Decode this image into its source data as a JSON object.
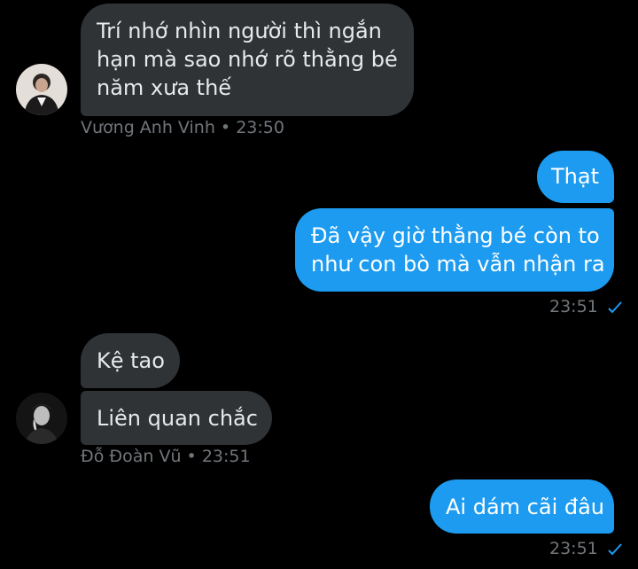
{
  "accent_color": "#1d9bf0",
  "received_bubble_color": "#2f3336",
  "messages": [
    {
      "lines": [
        "Trí nhớ nhìn người thì ngắn",
        "hạn mà sao nhớ rõ thằng bé",
        "năm xưa thế"
      ],
      "direction": "received"
    },
    {
      "lines": [
        "Thạt"
      ],
      "direction": "sent"
    },
    {
      "lines": [
        "Đã vậy giờ thằng bé còn to",
        "như con bò mà vẫn nhận ra"
      ],
      "direction": "sent"
    },
    {
      "lines": [
        "Kệ tao"
      ],
      "direction": "received"
    },
    {
      "lines": [
        "Liên quan chắc"
      ],
      "direction": "received"
    },
    {
      "lines": [
        "Ai dám cãi đâu"
      ],
      "direction": "sent"
    }
  ],
  "meta": [
    {
      "sender": "Vương Anh Vinh",
      "separator": "•",
      "time": "23:50"
    },
    {
      "time": "23:51",
      "status_icon": "check-icon"
    },
    {
      "sender": "Đỗ Đoàn Vũ",
      "separator": "•",
      "time": "23:51"
    },
    {
      "time": "23:51",
      "status_icon": "check-icon"
    }
  ]
}
